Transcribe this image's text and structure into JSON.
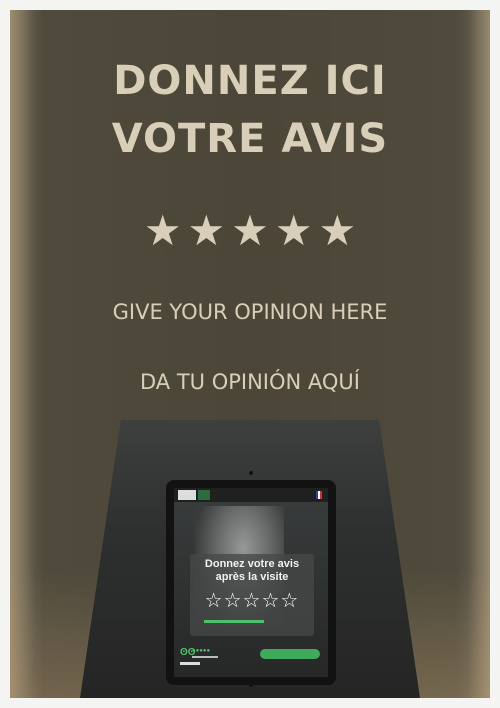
{
  "sign": {
    "line1": "DONNEZ ICI",
    "line2": "VOTRE AVIS",
    "stars": [
      "★",
      "★",
      "★",
      "★",
      "★"
    ],
    "english": "GIVE YOUR OPINION HERE",
    "spanish": "DA TU OPINIÓN AQUÍ"
  },
  "tablet": {
    "title": "Donnez votre avis après la visite",
    "star_glyph": "☆☆☆☆☆"
  },
  "colors": {
    "wall": "#4b4637",
    "sign_text": "#d9cfb8",
    "kiosk": "#2e302f",
    "accent_green": "#3faa59"
  }
}
